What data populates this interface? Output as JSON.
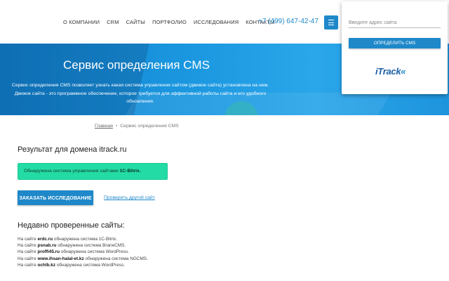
{
  "nav": {
    "links": [
      "О КОМПАНИИ",
      "CRM",
      "САЙТЫ",
      "ПОРТФОЛИО",
      "ИССЛЕДОВАНИЯ",
      "КОНТАКТЫ"
    ],
    "phone": "+7 (499) 647-42-47",
    "menu_icon": "menu-icon"
  },
  "hero": {
    "title": "Сервис определения CMS",
    "description_line1": "Сервис определения CMS позволяет узнать какая система управления сайтом (движок сайта) установлена на нем.",
    "description_line2": "Движок сайта - это программное обеспечение, которое требуется для эффективной работы сайта и его удобного",
    "description_line3": "обновления."
  },
  "breadcrumb": {
    "home": "Главная",
    "separator": "•",
    "current": "Сервис определения CMS"
  },
  "main": {
    "result_heading": "Результат для домена itrack.ru",
    "alert_text": "Обнаружена система управления сайтами",
    "alert_cms": "1С-Bitrix.",
    "order_button": "ЗАКАЗАТЬ ИССЛЕДОВАНИЕ",
    "check_other_link": "Проверить другой сайт",
    "recent_heading": "Недавно проверенные сайты:",
    "recent_items": [
      {
        "prefix": "На сайте",
        "domain": "erdc.ru",
        "suffix": "обнаружена система 1С-Bitrix."
      },
      {
        "prefix": "На сайте",
        "domain": "psnab.ru",
        "suffix": "обнаружена система BraneCMS."
      },
      {
        "prefix": "На сайте",
        "domain": "proffi45.ru",
        "suffix": "обнаружена система WordPress."
      },
      {
        "prefix": "На сайте",
        "domain": "www.ihsan-halal-et.kz",
        "suffix": "обнаружена система NGCMS."
      },
      {
        "prefix": "На сайте",
        "domain": "ochlb.kz",
        "suffix": "обнаружена система WordPress."
      }
    ]
  },
  "popup": {
    "input_placeholder": "Введите адрес сайта",
    "button_label": "ОПРЕДЕЛИТЬ CMS",
    "logo_main": "iTrack",
    "logo_accent": "«"
  },
  "colors": {
    "brand_blue": "#1e88c9",
    "success_green": "#23dca5"
  }
}
